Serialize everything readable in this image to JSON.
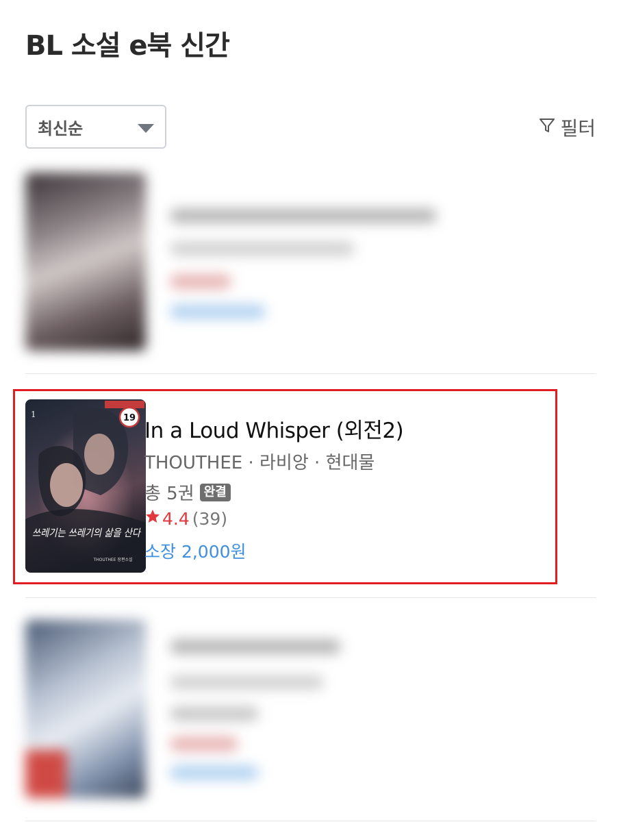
{
  "header": {
    "title": "BL 소설 e북 신간"
  },
  "sort": {
    "selected": "최신순"
  },
  "filter": {
    "label": "필터"
  },
  "featured_book": {
    "title": "In a Loud Whisper (외전2)",
    "meta": "THOUTHEE · 라비앙 · 현대물",
    "volumes": "총 5권",
    "status_badge": "완결",
    "rating": "4.4",
    "rating_count": "(39)",
    "price": "소장 2,000원",
    "cover_age_badge": "19",
    "cover_title": "쓰레기는 쓰레기의 삶을 산다",
    "cover_author": "THOUTHEE 장편소설"
  },
  "colors": {
    "accent_blue": "#3f8fe0",
    "rating_red": "#e0393f",
    "highlight_red": "#e21c23"
  }
}
